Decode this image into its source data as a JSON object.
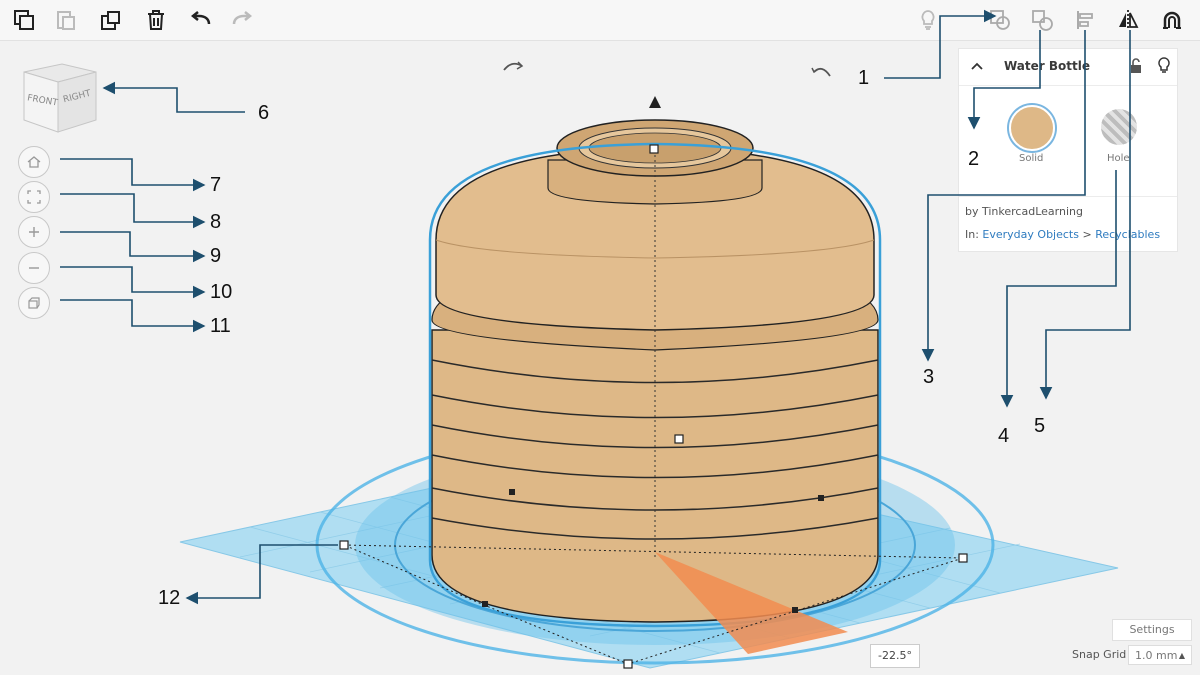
{
  "object": {
    "name": "Water Bottle",
    "solid_label": "Solid",
    "hole_label": "Hole",
    "author": "by TinkercadLearning",
    "category_prefix": "In:",
    "category": "Everyday Objects",
    "separator": ">",
    "subcategory": "Recyclables"
  },
  "view_cube": {
    "front": "FRONT",
    "right": "RIGHT"
  },
  "workplane": {
    "settings_label": "Settings",
    "snap_grid_label": "Snap Grid",
    "snap_grid_value": "1.0 mm",
    "rotation_readout": "-22.5°"
  },
  "callouts": [
    "1",
    "2",
    "3",
    "4",
    "5",
    "6",
    "7",
    "8",
    "9",
    "10",
    "11",
    "12"
  ],
  "colors": {
    "solid": "#deb887",
    "grid": "#8fd0ec",
    "selection": "#3aa0d8",
    "arrow": "#1e4f6e",
    "rotate_wedge": "#f28c50"
  }
}
